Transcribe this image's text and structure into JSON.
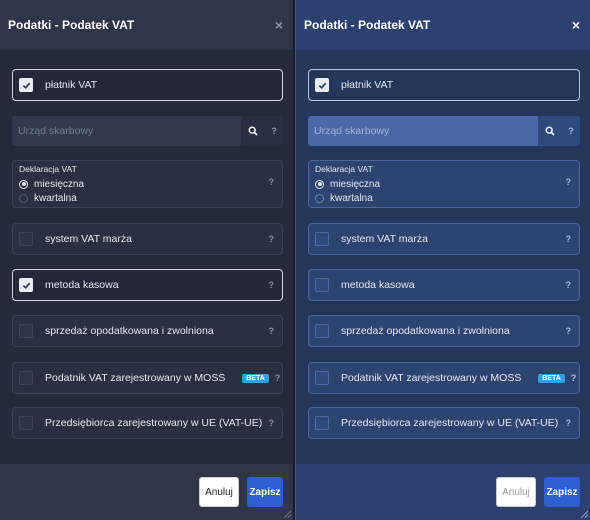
{
  "dialog": {
    "title": "Podatki - Podatek VAT",
    "close_glyph": "×",
    "checkbox_vat_payer": "płatnik VAT",
    "tax_office_placeholder": "Urząd skarbowy",
    "tax_office_value": "",
    "help_glyph": "?",
    "declaration_legend": "Deklaracja VAT",
    "declaration_options": [
      "miesięczna",
      "kwartalna"
    ],
    "checkbox_margin": "system VAT marża",
    "checkbox_cash": "metoda kasowa",
    "checkbox_taxed_exempt": "sprzedaż opodatkowana i zwolniona",
    "checkbox_moss": "Podatnik VAT zarejestrowany w MOSS",
    "beta_badge": "BETA",
    "checkbox_vat_ue": "Przedsiębiorca zarejestrowany w UE (VAT-UE)",
    "cancel_label": "Anuluj",
    "save_label": "Zapisz"
  },
  "themes": [
    {
      "name": "dark",
      "background": "#262b3b",
      "header": "#30364a"
    },
    {
      "name": "blue",
      "background": "#243659",
      "header": "#2d4170"
    }
  ],
  "accent": "#2f5fd1",
  "icons": [
    "close-icon",
    "search-icon",
    "help-icon",
    "check-icon",
    "resize-grip-icon"
  ],
  "state": {
    "dark": {
      "vat_payer": true,
      "declaration": "miesięczna",
      "margin": false,
      "cash": true,
      "taxed_exempt": false,
      "moss": false,
      "vat_ue": false
    },
    "blue": {
      "vat_payer": true,
      "declaration": "miesięczna",
      "margin": false,
      "cash": false,
      "taxed_exempt": false,
      "moss": false,
      "vat_ue": false
    }
  }
}
